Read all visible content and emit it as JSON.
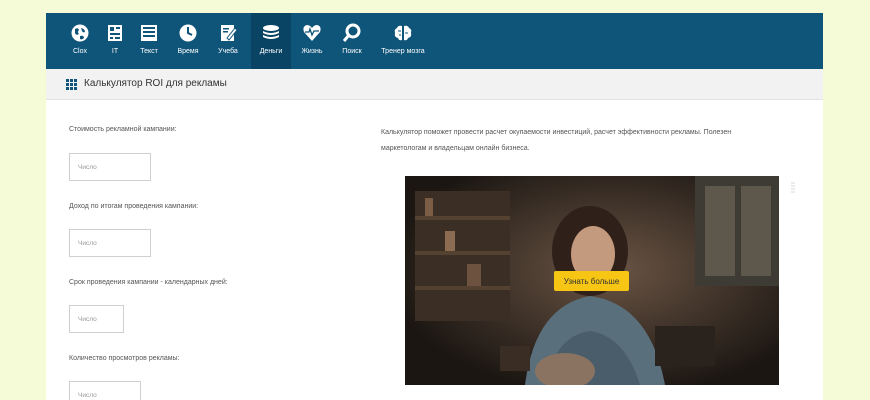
{
  "nav": {
    "items": [
      {
        "label": "Сlox",
        "icon": "globe-icon"
      },
      {
        "label": "IT",
        "icon": "circuit-icon"
      },
      {
        "label": "Текст",
        "icon": "document-icon"
      },
      {
        "label": "Время",
        "icon": "clock-icon"
      },
      {
        "label": "Учеба",
        "icon": "notebook-pencil-icon"
      },
      {
        "label": "Деньги",
        "icon": "coins-icon",
        "active": true
      },
      {
        "label": "Жизнь",
        "icon": "heart-pulse-icon"
      },
      {
        "label": "Поиск",
        "icon": "search-icon"
      },
      {
        "label": "Тренер мозга",
        "icon": "brain-icon"
      }
    ]
  },
  "page": {
    "title": "Калькулятор ROI для рекламы"
  },
  "form": {
    "fields": [
      {
        "label": "Стоимость рекламной кампании:",
        "placeholder": "Число"
      },
      {
        "label": "Доход по итогам проведения кампании:",
        "placeholder": "Число"
      },
      {
        "label": "Срок проведения кампании - календарных дней:",
        "placeholder": "Число"
      },
      {
        "label": "Количество просмотров рекламы:",
        "placeholder": "Число"
      }
    ]
  },
  "description": "Калькулятор поможет провести расчет окупаемости инвестиций, расчет эффективности рекламы. Полезен маркетологам и владельцам онлайн бизнеса.",
  "video": {
    "cta_label": "Узнать больше"
  },
  "colors": {
    "nav_bg": "#0f5479",
    "nav_active": "#0a4465",
    "cta": "#f7c615",
    "page_bg": "#f5fbd7"
  }
}
